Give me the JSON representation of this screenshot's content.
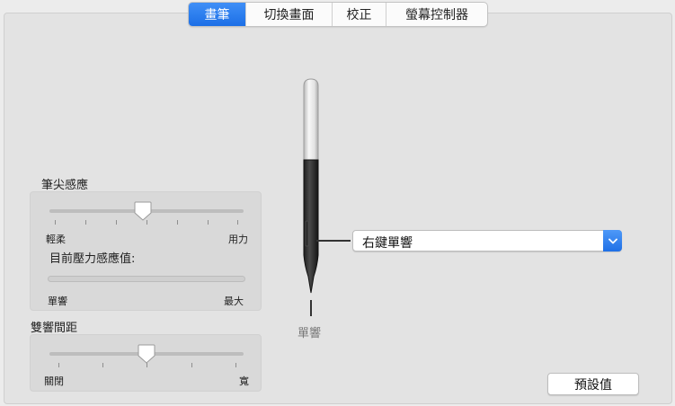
{
  "tabs": [
    {
      "label": "畫筆",
      "active": true
    },
    {
      "label": "切換畫面",
      "active": false
    },
    {
      "label": "校正",
      "active": false
    },
    {
      "label": "螢幕控制器",
      "active": false
    }
  ],
  "tip_feel": {
    "title": "筆尖感應",
    "min_label": "輕柔",
    "max_label": "用力",
    "value_fraction": 0.48,
    "current_pressure_label": "目前壓力感應值:",
    "pressure_min_label": "單響",
    "pressure_max_label": "最大",
    "current_pressure_fraction": 0
  },
  "double_click_distance": {
    "title": "雙響間距",
    "min_label": "關閉",
    "max_label": "寬",
    "value_fraction": 0.5
  },
  "pen": {
    "side_switch_value": "右鍵單響",
    "tip_label": "單響"
  },
  "buttons": {
    "default_label": "預設值"
  },
  "colors": {
    "accent": "#1c6fe6",
    "pane": "#e3e3e3"
  }
}
